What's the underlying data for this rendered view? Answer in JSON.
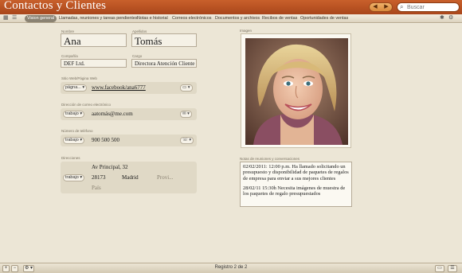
{
  "app": {
    "title": "Contactos y Clientes"
  },
  "search": {
    "placeholder": "Buscar"
  },
  "tabs": [
    {
      "label": "Vision general"
    },
    {
      "label": "Llamadas, reuniones y tareas pendientes"
    },
    {
      "label": "Notas e historial"
    },
    {
      "label": "Correos electrónicos"
    },
    {
      "label": "Documentos y archivos"
    },
    {
      "label": "Recibos de ventas"
    },
    {
      "label": "Oportunidades de ventas"
    }
  ],
  "contact": {
    "first_name_label": "Nombre",
    "first_name": "Ana",
    "last_name_label": "Apellidos",
    "last_name": "Tomás",
    "company_label": "Compañía",
    "company": "DEF Ltd.",
    "position_label": "Cargo",
    "position": "Directora Atención Cliente",
    "website_label": "Sitio Web/Página Web",
    "website_type": "págna...",
    "website": "www.facebook/ana6777",
    "email_label": "Dirección de correo electrónico",
    "email_type": "trabajo",
    "email": "aatomás@me.com",
    "phone_label": "Número de teléfono",
    "phone_type": "trabajo",
    "phone": "900 500 500",
    "address_label": "Direcciones",
    "address_type": "trabajo",
    "street": "Av Principal, 32",
    "postcode": "28173",
    "city": "Madrid",
    "province": "Provi...",
    "country": "País"
  },
  "image_label": "Imagen",
  "notes": {
    "label": "Notas de reuniones y conversaciones",
    "entries": [
      "02/02/2011: 12:00 p.m. Ha llamado solicitando un presupuesto y disponibilidad de paquetes de regalos de empresa para enviar a sus mejores clientes",
      "28/02/11 15:30h Necesita imágenes de muestra de los paquetes de regalo presupuestados"
    ]
  },
  "status": {
    "record": "Registro 2 de 2"
  },
  "icons": {
    "back": "◀",
    "forward": "▶",
    "search": "⌕",
    "grid": "▦",
    "list": "☰",
    "add": "+",
    "remove": "−",
    "gear": "⚙",
    "settings": "✱",
    "dropdown": "▾",
    "phone_menu": "☏",
    "mail_menu": "✉",
    "web_menu": "▭"
  },
  "colors": {
    "titlebar": "#b8502a",
    "background": "#ece6d6",
    "active_tab": "#8a8272"
  }
}
